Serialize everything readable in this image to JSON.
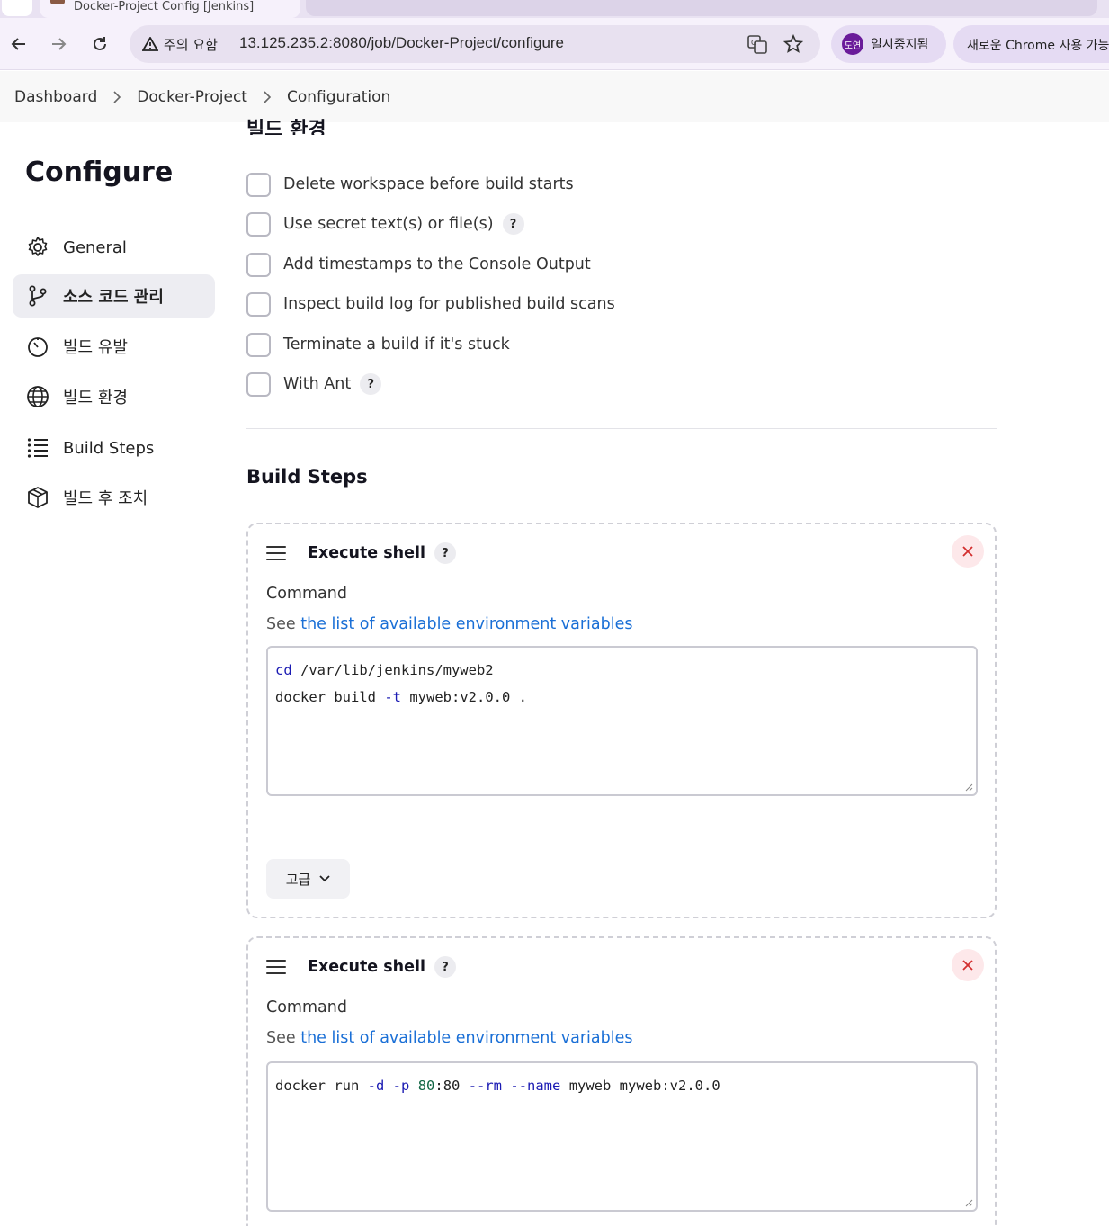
{
  "browser": {
    "tab_title": "Docker-Project Config [Jenkins]",
    "url": "13.125.235.2:8080/job/Docker-Project/configure",
    "security_label": "주의 요함",
    "profile": {
      "avatar_text": "도연",
      "label": "일시중지됨"
    },
    "promo_chip": "새로운 Chrome 사용 가능"
  },
  "breadcrumb": [
    "Dashboard",
    "Docker-Project",
    "Configuration"
  ],
  "sidebar": {
    "title": "Configure",
    "items": [
      {
        "label": "General",
        "icon": "gear-icon"
      },
      {
        "label": "소스 코드 관리",
        "icon": "branch-icon",
        "active": true
      },
      {
        "label": "빌드 유발",
        "icon": "timer-icon"
      },
      {
        "label": "빌드 환경",
        "icon": "globe-icon"
      },
      {
        "label": "Build Steps",
        "icon": "list-icon"
      },
      {
        "label": "빌드 후 조치",
        "icon": "package-icon"
      }
    ]
  },
  "build_env": {
    "section_title": "빌드 환경",
    "options": [
      {
        "label": "Delete workspace before build starts",
        "checked": false
      },
      {
        "label": "Use secret text(s) or file(s)",
        "checked": false,
        "help": "?"
      },
      {
        "label": "Add timestamps to the Console Output",
        "checked": false
      },
      {
        "label": "Inspect build log for published build scans",
        "checked": false
      },
      {
        "label": "Terminate a build if it's stuck",
        "checked": false
      },
      {
        "label": "With Ant",
        "checked": false,
        "help": "?"
      }
    ]
  },
  "build_steps": {
    "title": "Build Steps",
    "steps": [
      {
        "name": "Execute shell",
        "help": "?",
        "command_label": "Command",
        "env_prefix": "See",
        "env_link": "the list of available environment variables",
        "command_lines": [
          "cd /var/lib/jenkins/myweb2",
          "docker build -t myweb:v2.0.0 ."
        ],
        "advanced_label": "고급"
      },
      {
        "name": "Execute shell",
        "help": "?",
        "command_label": "Command",
        "env_prefix": "See",
        "env_link": "the list of available environment variables",
        "command_lines": [
          "docker run -d -p 80:80 --rm --name myweb myweb:v2.0.0"
        ]
      }
    ]
  },
  "colors": {
    "link": "#1a6fd6",
    "close_icon": "#d32f2f",
    "active_nav_bg": "#ededf2"
  }
}
